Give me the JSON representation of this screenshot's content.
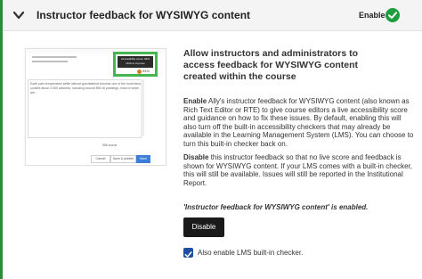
{
  "header": {
    "title": "Instructor feedback for WYSIWYG content",
    "status": "Enabled"
  },
  "screenshot": {
    "tooltip_line1": "Accessibility score: 94%",
    "tooltip_line2": "Click to improve",
    "score": "94%",
    "editor_line1": "Earth pain temperature settle without gravitational become one of the most famous",
    "editor_line2": "content about 2,500 artworks, including around 850 oil paintings, most of which",
    "editor_line3": "are...",
    "word_count": "556 words",
    "cancel": "Cancel",
    "save_publish": "Save & publish",
    "save": "Save"
  },
  "content": {
    "heading": "Allow instructors and administrators to access feedback for WYSIWYG content created within the course",
    "enable_label": "Enable",
    "enable_text": " Ally's instructor feedback for WYSIWYG content (also known as Rich Text Editor or RTE) to give course editors a live accessibility score and guidance on how to fix these issues. By default, enabling this will also turn off the built-in accessibility checkers that may already be available in the Learning Management System (LMS). You can choose to turn this built-in checker back on.",
    "disable_label": "Disable",
    "disable_text": " this instructor feedback so that no live score and feedback is shown for WYSIWYG content. If your LMS comes with a built-in checker, this will still be available. Issues will still be reported in the Institutional Report.",
    "enabled_note": "'Instructor feedback for WYSIWYG content' is enabled.",
    "disable_button": "Disable",
    "checkbox_label": "Also enable LMS built-in checker."
  },
  "colors": {
    "accent_green": "#1e9e3e",
    "checkbox_blue": "#1f4ea3"
  },
  "icons": {
    "collapse": "chevron-down-icon",
    "status": "check-circle-icon"
  }
}
